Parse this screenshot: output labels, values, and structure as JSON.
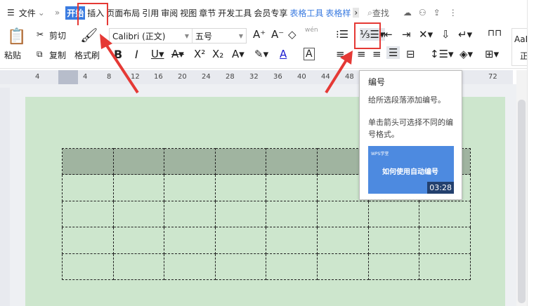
{
  "menubar": {
    "file_label": "文件",
    "tabs": [
      "开始",
      "插入",
      "页面布局",
      "引用",
      "审阅",
      "视图",
      "章节",
      "开发工具",
      "会员专享"
    ],
    "context_tabs": [
      "表格工具",
      "表格样"
    ],
    "search_label": "查找"
  },
  "toolbar": {
    "paste": "粘贴",
    "cut": "剪切",
    "copy": "复制",
    "format_painter": "格式刷",
    "font_name": "Calibri (正文)",
    "font_size": "五号",
    "pinyin": "wén",
    "style_preview": "AaBbC",
    "style_name": "正文"
  },
  "ruler": {
    "ticks": [
      "4",
      "4",
      "8",
      "12",
      "16",
      "20",
      "24",
      "28",
      "32",
      "36",
      "40",
      "44",
      "48",
      "72"
    ]
  },
  "tooltip": {
    "title": "编号",
    "line1": "给所选段落添加编号。",
    "line2": "单击箭头可选择不同的编号格式。",
    "video_brand": "WPS学堂",
    "video_title": "如何使用自动编号",
    "video_duration": "03:28"
  },
  "table": {
    "rows": 5,
    "cols": 8
  },
  "colors": {
    "accent": "#3a7be0",
    "highlight": "#e53935",
    "page": "#cde6cd",
    "header_row": "#a0b4a0"
  }
}
